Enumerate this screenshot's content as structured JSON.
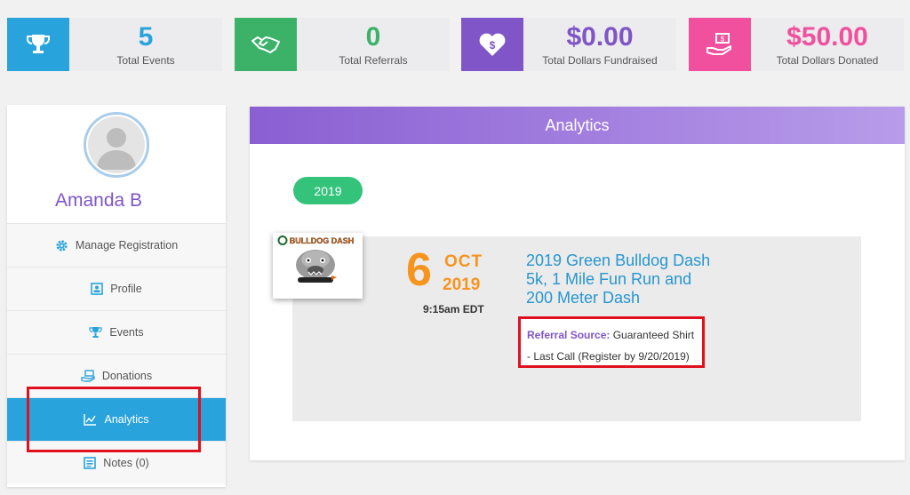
{
  "stats": [
    {
      "value": "5",
      "label": "Total Events",
      "icon": "trophy-icon",
      "icon_bg": "#29a3dc",
      "value_color": "#29a3dc"
    },
    {
      "value": "0",
      "label": "Total Referrals",
      "icon": "handshake-icon",
      "icon_bg": "#3cb269",
      "value_color": "#3cb269"
    },
    {
      "value": "$0.00",
      "label": "Total Dollars Fundraised",
      "icon": "heart-dollar-icon",
      "icon_bg": "#7f55c8",
      "value_color": "#7f55c8"
    },
    {
      "value": "$50.00",
      "label": "Total Dollars Donated",
      "icon": "hand-money-icon",
      "icon_bg": "#f0509d",
      "value_color": "#f0509d"
    }
  ],
  "user": {
    "name": "Amanda B"
  },
  "nav": [
    {
      "label": "Manage Registration",
      "icon": "gear-icon"
    },
    {
      "label": "Profile",
      "icon": "profile-card-icon"
    },
    {
      "label": "Events",
      "icon": "trophy-icon"
    },
    {
      "label": "Donations",
      "icon": "donation-icon"
    },
    {
      "label": "Analytics",
      "icon": "chart-icon",
      "active": true
    },
    {
      "label": "Notes (0)",
      "icon": "notes-icon"
    }
  ],
  "panel": {
    "title": "Analytics"
  },
  "year": "2019",
  "event": {
    "logo_text": "BULLDOG DASH",
    "day": "6",
    "month": "OCT",
    "year": "2019",
    "time": "9:15am EDT",
    "title": "2019 Green Bulldog Dash 5k, 1 Mile Fun Run and 200 Meter Dash",
    "referral_label": "Referral Source:",
    "referral_value": " Guaranteed Shirt - Last Call (Register by 9/20/2019)"
  },
  "colors": {
    "accent_blue": "#29a3dc",
    "purple": "#7f55c8",
    "green": "#33c37a",
    "orange": "#f7941d",
    "highlight_red": "#e0101f"
  }
}
